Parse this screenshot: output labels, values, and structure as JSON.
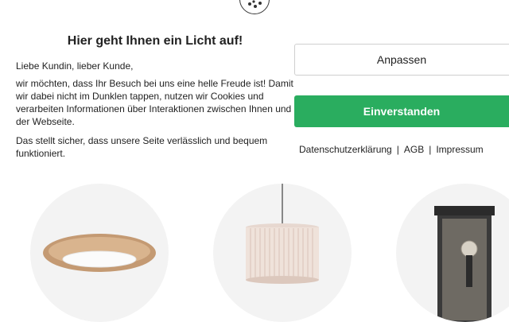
{
  "modal": {
    "title": "Hier geht Ihnen ein Licht auf!",
    "greeting": "Liebe Kundin, lieber Kunde,",
    "body": "wir möchten, dass Ihr Besuch bei uns eine helle Freude ist! Damit wir dabei nicht im Dunklen tappen, nutzen wir Cookies und verarbeiten Informationen über Interaktionen zwischen Ihnen und der Webseite.",
    "note": "Das stellt sicher, dass unsere Seite verlässlich und bequem funktioniert.",
    "customize_label": "Anpassen",
    "accept_label": "Einverstanden",
    "links": [
      "Datenschutzerklärung",
      "AGB",
      "Impressum"
    ],
    "link_separator": "|",
    "badge_icon": "cookie-icon"
  },
  "products": {
    "icons": [
      "ceiling-lamp-icon",
      "pendant-lamp-icon",
      "wall-lantern-icon"
    ]
  },
  "colors": {
    "accent": "#2aad5f",
    "circle_bg": "#f3f3f3"
  }
}
